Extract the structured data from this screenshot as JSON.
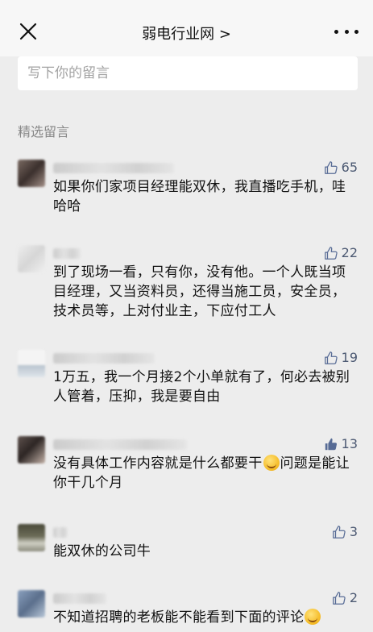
{
  "nav": {
    "title": "弱电行业网 >"
  },
  "comment_input": {
    "placeholder": "写下你的留言"
  },
  "section_title": "精选留言",
  "comments": [
    {
      "likes": "65",
      "liked": false,
      "text": "如果你们家项目经理能双休，我直播吃手机，哇哈哈"
    },
    {
      "likes": "22",
      "liked": false,
      "text": "到了现场一看，只有你，没有他。一个人既当项目经理，又当资料员，还得当施工员，安全员，技术员等，上对付业主，下应付工人"
    },
    {
      "likes": "19",
      "liked": false,
      "text": "1万五，我一个月接2个小单就有了，何必去被别人管着，压抑，我是要自由"
    },
    {
      "likes": "13",
      "liked": true,
      "text_before_emoji": "没有具体工作内容就是什么都要干",
      "text_after_emoji": "问题是能让你干几个月"
    },
    {
      "likes": "3",
      "liked": false,
      "text": "能双休的公司牛"
    },
    {
      "likes": "2",
      "liked": false,
      "text": "不知道招聘的老板能不能看到下面的评论"
    }
  ],
  "colors": {
    "background": "#ededed",
    "like_active": "#576b95",
    "like_inactive": "#4d5a73"
  }
}
